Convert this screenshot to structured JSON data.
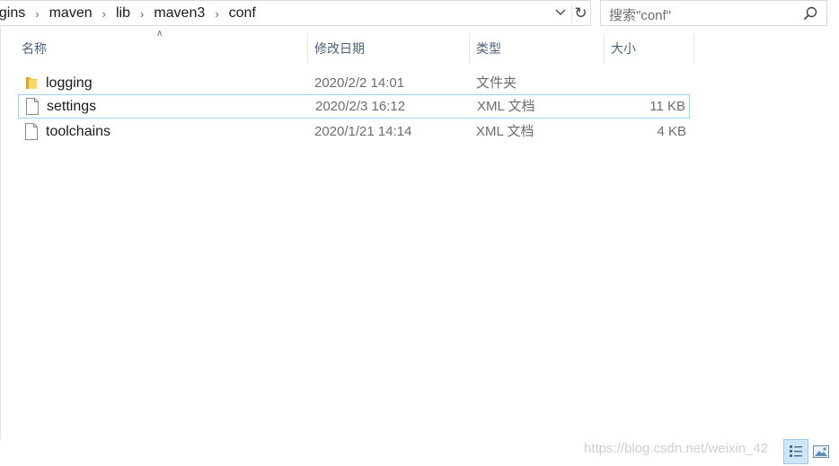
{
  "address_bar": {
    "breadcrumb": [
      "ugins",
      "maven",
      "lib",
      "maven3",
      "conf"
    ]
  },
  "search": {
    "placeholder": "搜索\"conf\""
  },
  "columns": {
    "name": "名称",
    "date_modified": "修改日期",
    "type": "类型",
    "size": "大小"
  },
  "files": [
    {
      "name": "logging",
      "date": "2020/2/2 14:01",
      "type": "文件夹",
      "size": "",
      "icon": "folder-icon"
    },
    {
      "name": "settings",
      "date": "2020/2/3 16:12",
      "type": "XML 文档",
      "size": "11 KB",
      "icon": "file-icon"
    },
    {
      "name": "toolchains",
      "date": "2020/1/21 14:14",
      "type": "XML 文档",
      "size": "4 KB",
      "icon": "file-icon"
    }
  ],
  "watermark": "https://blog.csdn.net/weixin_42",
  "colors": {
    "selection_border": "#99d1ff",
    "header_text": "#4c607a",
    "folder": "#f3c042"
  }
}
